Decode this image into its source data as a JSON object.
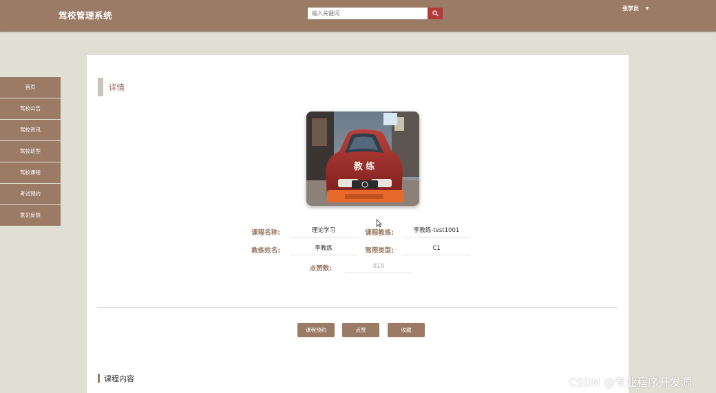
{
  "header": {
    "brand": "驾校管理系统",
    "search_placeholder": "输入关键词",
    "user_name": "张学员",
    "user_caret": "▼"
  },
  "sidebar": {
    "items": [
      {
        "label": "首页"
      },
      {
        "label": "驾校公告"
      },
      {
        "label": "驾校资讯"
      },
      {
        "label": "驾校班型"
      },
      {
        "label": "驾校课程"
      },
      {
        "label": "考试预约"
      },
      {
        "label": "意见反馈"
      }
    ]
  },
  "detail": {
    "title": "详情",
    "photo_caption": "教 练",
    "fields": {
      "course_name_label": "课程名称:",
      "course_name_value": "理论学习",
      "coach_label": "课程教练:",
      "coach_value": "李教练-test1001",
      "coach_name_label": "教练姓名:",
      "coach_name_value": "李教练",
      "license_label": "驾照类型:",
      "license_value": "C1",
      "likes_label": "点赞数:",
      "likes_value": "818"
    }
  },
  "actions": {
    "book_label": "课程预约",
    "like_label": "点赞",
    "favorite_label": "收藏"
  },
  "content_section": {
    "title": "课程内容"
  },
  "watermark": "CSDN @专业程序开发源",
  "colors": {
    "primary": "#9b7b66",
    "background": "#e0dfd4",
    "search_button": "#b13a3a",
    "detail_title": "#9b5d4c"
  }
}
